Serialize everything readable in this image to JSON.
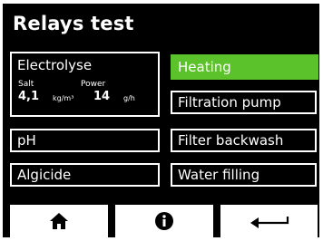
{
  "title": "Relays test",
  "left": {
    "electrolyse": {
      "label": "Electrolyse",
      "salt_label": "Salt",
      "salt_value": "4,1",
      "salt_unit": "kg/m³",
      "power_label": "Power",
      "power_value": "14",
      "power_unit": "g/h"
    },
    "ph_label": "pH",
    "algicide_label": "Algicide"
  },
  "right": {
    "heating_label": "Heating",
    "heating_active": true,
    "filtration_label": "Filtration pump",
    "backwash_label": "Filter backwash",
    "water_label": "Water filling"
  },
  "footer": {
    "home_icon": "home-icon",
    "info_icon": "info-icon",
    "back_icon": "back-arrow-icon"
  },
  "colors": {
    "background": "#000000",
    "active": "#5cc22b",
    "foreground": "#ffffff"
  }
}
